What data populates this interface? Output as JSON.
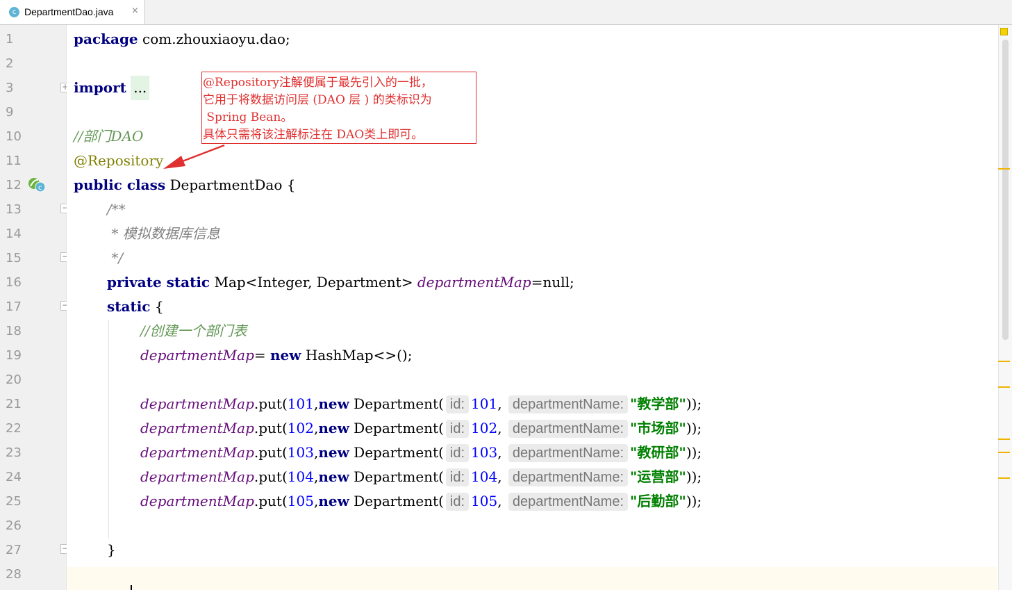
{
  "tab": {
    "label": "DepartmentDao.java",
    "icon": "java-class-icon",
    "close": "×"
  },
  "gutter": {
    "line_numbers": [
      "1",
      "2",
      "3",
      "9",
      "10",
      "11",
      "12",
      "13",
      "14",
      "15",
      "16",
      "17",
      "18",
      "19",
      "20",
      "21",
      "22",
      "23",
      "24",
      "25",
      "26",
      "27",
      "28"
    ]
  },
  "code": {
    "l1_kw": "package",
    "l1_rest": " com.zhouxiaoyu.dao;",
    "l3_kw": "import",
    "l3_fold": "...",
    "l10": "//部门DAO",
    "l11": "@Repository",
    "l12_kw": "public class",
    "l12_rest": " DepartmentDao {",
    "l13": "/**",
    "l14": " * 模拟数据库信息",
    "l15": " */",
    "l16_kw": "private static",
    "l16_type": " Map<Integer, Department> ",
    "l16_field": "departmentMap",
    "l16_eq": "=null;",
    "l17_kw": "static",
    "l17_rest": " {",
    "l18": "//创建一个部门表",
    "l19_field": "departmentMap",
    "l19_eq": "= ",
    "l19_kw": "new",
    "l19_rest": " HashMap<>();",
    "field": "departmentMap",
    "put": ".put(",
    "new": "new",
    "dept": " Department(",
    "hint_id": "id:",
    "hint_name": "departmentName:",
    "rows": [
      {
        "key": "101",
        "id": "101",
        "name": "\"教学部\""
      },
      {
        "key": "102",
        "id": "102",
        "name": "\"市场部\""
      },
      {
        "key": "103",
        "id": "103",
        "name": "\"教研部\""
      },
      {
        "key": "104",
        "id": "104",
        "name": "\"运营部\""
      },
      {
        "key": "105",
        "id": "105",
        "name": "\"后勤部\""
      }
    ],
    "row_end": "));",
    "l27": "}"
  },
  "callout": {
    "lines": [
      "@Repository注解便属于最先引入的一批，",
      "它用于将数据访问层 (DAO 层 ) 的类标识为",
      " Spring Bean。",
      "具体只需将该注解标注在 DAO类上即可。"
    ]
  },
  "colors": {
    "keyword": "#000080",
    "annotation": "#808000",
    "field": "#660e7a",
    "string": "#008000",
    "number": "#0000ff",
    "callout": "#e03030"
  }
}
